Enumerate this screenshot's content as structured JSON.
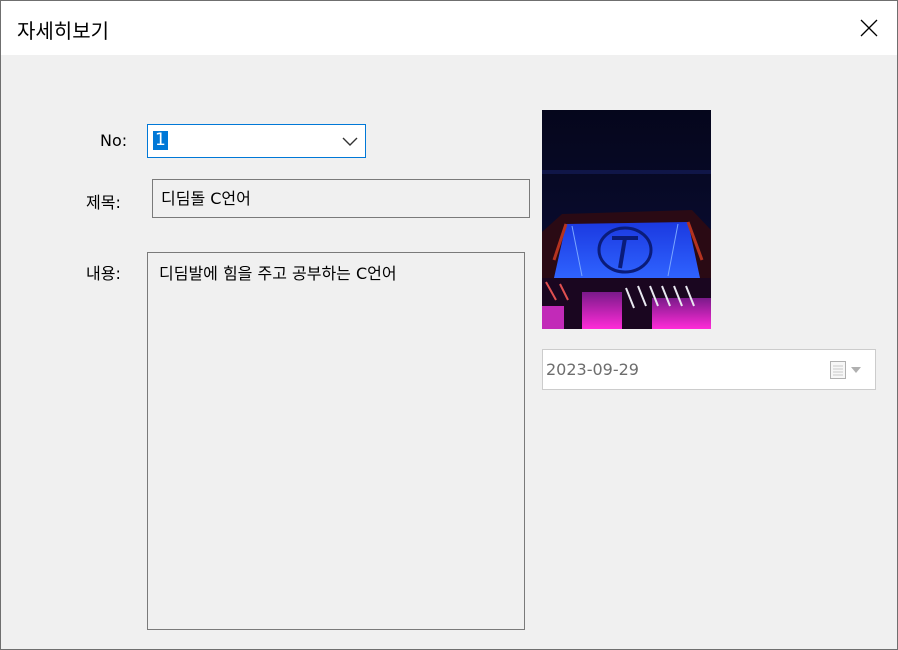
{
  "window": {
    "title": "자세히보기"
  },
  "icons": {
    "close": "close-icon",
    "dropdown": "chevron-down-icon",
    "calendar": "calendar-icon"
  },
  "form": {
    "no_label": "No:",
    "no_value": "1",
    "title_label": "제목:",
    "title_value": "디딤돌 C언어",
    "content_label": "내용:",
    "content_value": "디딤발에 힘을 주고 공부하는 C언어",
    "date_value": "2023-09-29"
  },
  "colors": {
    "accent": "#0078d7",
    "background": "#f0f0f0",
    "titlebar": "#ffffff"
  }
}
